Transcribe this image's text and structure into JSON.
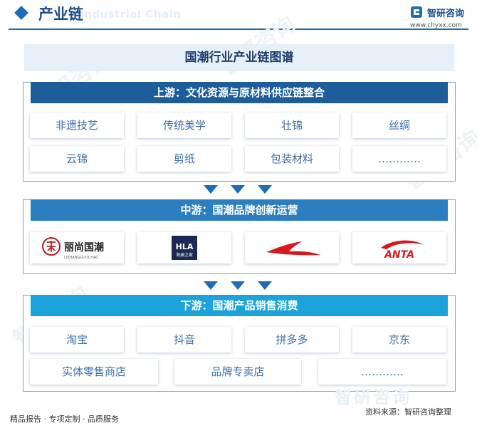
{
  "header": {
    "title": "产业链",
    "ghost_text": "Industrial Chain",
    "brand_name": "智研咨询",
    "brand_url": "www.chyxx.com"
  },
  "main_title": "国潮行业产业链图谱",
  "upstream": {
    "title": "上游：文化资源与原材料供应链整合",
    "items": [
      "非遗技艺",
      "传统美学",
      "壮锦",
      "丝绸",
      "云锦",
      "剪纸",
      "包装材料",
      "…………"
    ]
  },
  "midstream": {
    "title": "中游：国潮品牌创新运营",
    "brands": [
      {
        "icon": "lishang-guochao-logo",
        "text": "丽尚国潮",
        "sub": "LISHANGGUOCHAO"
      },
      {
        "icon": "hla-logo",
        "text": "HLA",
        "sub": "海澜之家"
      },
      {
        "icon": "li-ning-logo"
      },
      {
        "icon": "anta-logo",
        "text": "ANTA"
      }
    ]
  },
  "downstream": {
    "title": "下游：国潮产品销售消费",
    "items_row1": [
      "淘宝",
      "抖音",
      "拼多多",
      "京东"
    ],
    "items_row2": [
      "实体零售商店",
      "品牌专卖店",
      "…………"
    ]
  },
  "footer": {
    "left": "精品报告 · 专项定制 · 品质服务",
    "source": "资料来源：智研咨询整理",
    "watermark": "智研咨询"
  },
  "colors": {
    "upstream_header": "#1d5d99",
    "midstream_header": "#2b7fc1",
    "downstream_header": "#1da3db",
    "arrow": "#1b6eb5"
  }
}
